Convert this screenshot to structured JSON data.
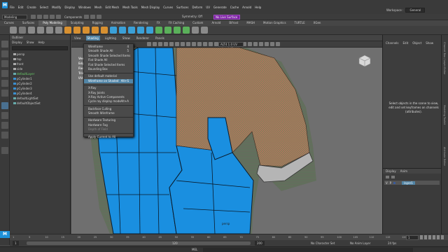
{
  "app": {
    "logo": "M",
    "title": "Maya"
  },
  "menubar": {
    "items": [
      "File",
      "Edit",
      "Create",
      "Select",
      "Modify",
      "Display",
      "Windows",
      "Mesh",
      "Edit Mesh",
      "Mesh Tools",
      "Mesh Display",
      "Curves",
      "Surfaces",
      "Deform",
      "UV",
      "Generate",
      "Cache",
      "Arnold",
      "Help"
    ],
    "workspace_label": "Workspace :",
    "workspace_value": "General"
  },
  "statusline": {
    "mode": "Modeling",
    "components_label": "Components",
    "symmetry": "Symmetry: Off",
    "live_field": "No Live Surface"
  },
  "shelf": {
    "tabs": [
      "Curves",
      "Surfaces",
      "Poly Modeling",
      "Sculpting",
      "Rigging",
      "Animation",
      "Rendering",
      "FX",
      "FX Caching",
      "Custom",
      "Arnold",
      "Bifrost",
      "MASH",
      "Motion Graphics",
      "TURTLE",
      "XGen"
    ],
    "active_tab": "Poly Modeling"
  },
  "outliner": {
    "title": "Outliner",
    "menus": [
      "Display",
      "Show",
      "Help"
    ],
    "items": [
      "persp",
      "top",
      "front",
      "side",
      "defaultLayer",
      "pCylinder1",
      "pCylinder2",
      "pCylinder3",
      "pCylinder4",
      "defaultLightSet",
      "defaultObjectSet"
    ]
  },
  "panel": {
    "menus": [
      "View",
      "Shading",
      "Lighting",
      "Show",
      "Renderer",
      "Panels"
    ],
    "open_menu": "Shading",
    "camera_field": "ALT4 1.0 UV view (all)",
    "hud": [
      "Verts:",
      "Edges:",
      "Faces:",
      "Tris:",
      "UVs:"
    ],
    "camera_name": "persp"
  },
  "shading_menu": {
    "items": [
      {
        "label": "Wireframe",
        "shortcut": "4"
      },
      {
        "label": "Smooth Shade All",
        "shortcut": "5"
      },
      {
        "label": "Smooth Shade Selected Items",
        "shortcut": ""
      },
      {
        "label": "Flat Shade All",
        "shortcut": ""
      },
      {
        "label": "Flat Shade Selected Items",
        "shortcut": ""
      },
      {
        "label": "Bounding Box",
        "shortcut": ""
      },
      {
        "label": "Use default material",
        "shortcut": ""
      },
      {
        "label": "Wireframe on Shaded",
        "shortcut": "Alt+S",
        "highlight": true
      },
      {
        "label": "X-Ray",
        "shortcut": ""
      },
      {
        "label": "X-Ray Joints",
        "shortcut": ""
      },
      {
        "label": "X-Ray Active Components",
        "shortcut": ""
      },
      {
        "label": "Cycle ray display mode",
        "shortcut": "Alt+A"
      },
      {
        "label": "Backface Culling",
        "shortcut": ""
      },
      {
        "label": "Smooth Wireframe",
        "shortcut": ""
      },
      {
        "label": "Hardware Texturing",
        "shortcut": ""
      },
      {
        "label": "Hardware Fog",
        "shortcut": ""
      },
      {
        "label": "Depth of Field",
        "shortcut": "",
        "dim": true
      },
      {
        "label": "Apply Current to All",
        "shortcut": ""
      }
    ]
  },
  "channelbox": {
    "menus": [
      "Channels",
      "Edit",
      "Object",
      "Show"
    ],
    "hint": "Select objects in the scene to view, edit and set keyframes on channels (attributes)."
  },
  "layers": {
    "tabs": [
      "Display",
      "Anim"
    ],
    "layer_name": "layer1"
  },
  "rightstrip": [
    "Channel Box / Layer Editor",
    "Modeling Toolkit",
    "Attribute Editor"
  ],
  "timeslider": {
    "ticks": [
      "1",
      "5",
      "10",
      "15",
      "20",
      "25",
      "30",
      "35",
      "40",
      "45",
      "50",
      "55",
      "60",
      "65",
      "70",
      "75",
      "80",
      "85",
      "90",
      "95",
      "100",
      "105",
      "110",
      "115",
      "120"
    ],
    "current": "1"
  },
  "rangeslider": {
    "start": "1",
    "end": "120",
    "anim_end": "200",
    "char_set": "No Character Set",
    "anim_layer": "No Anim Layer",
    "fps": "24 fps"
  },
  "cmdline": {
    "lang": "MEL"
  },
  "colors": {
    "accent": "#5285a6",
    "maya_blue": "#1e90d8",
    "mesh_blue": "#1a8fe0",
    "shirt_red": "#b0705a",
    "symmetry_purple": "#7b1fa2"
  }
}
